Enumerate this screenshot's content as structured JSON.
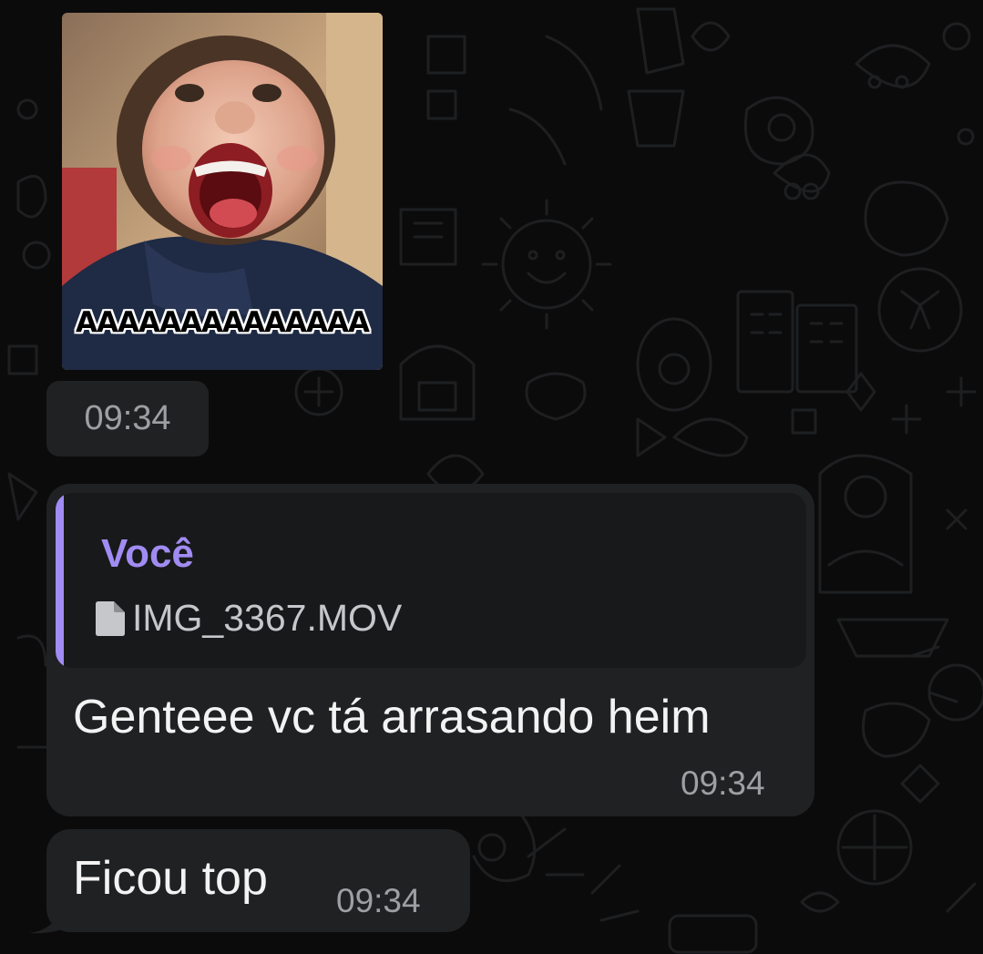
{
  "sticker": {
    "caption": "AAAAAAAAAAAAAA",
    "time": "09:34"
  },
  "reply_message": {
    "quote_author": "Você",
    "quote_file": "IMG_3367.MOV",
    "text": "Genteee vc tá arrasando heim",
    "time": "09:34"
  },
  "short_message": {
    "text": "Ficou top",
    "time": "09:34"
  },
  "colors": {
    "background": "#0b0b0c",
    "bubble": "#202122",
    "quote_accent": "#a18cf3",
    "timestamp": "#9da0a3"
  }
}
